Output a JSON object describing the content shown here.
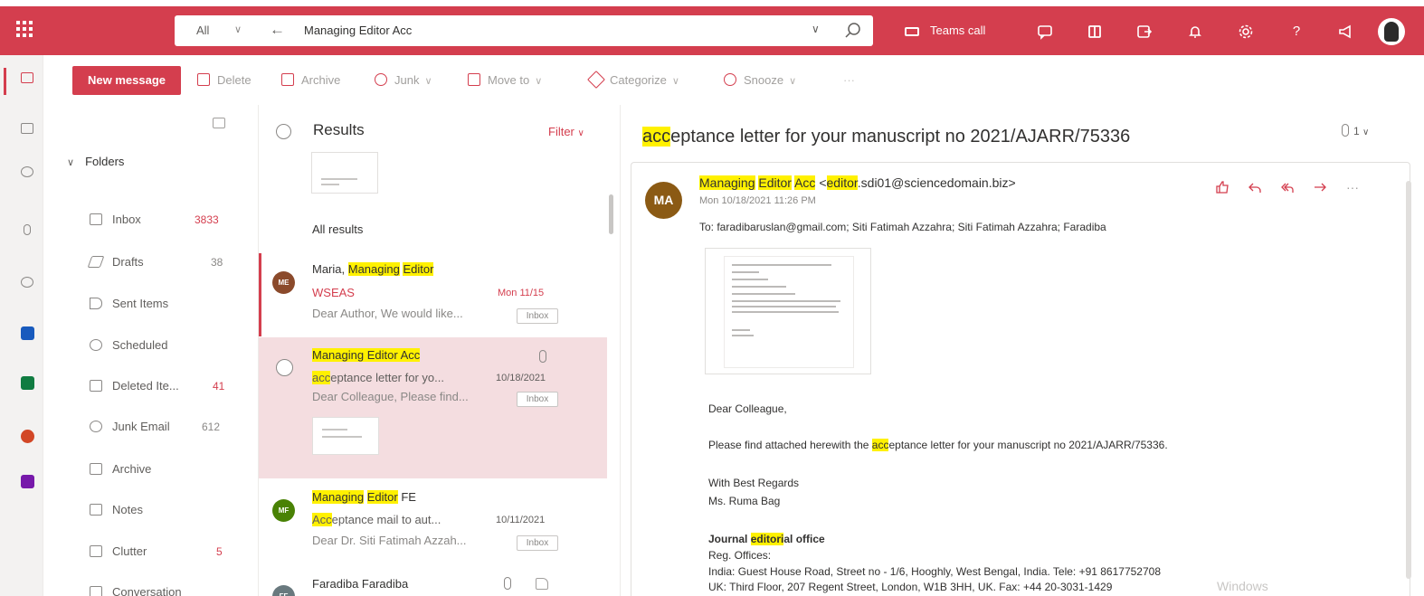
{
  "header": {
    "search_scope": "All",
    "search_query": "Managing Editor Acc",
    "teams_call": "Teams call"
  },
  "toolbar": {
    "new_message": "New message",
    "delete": "Delete",
    "archive": "Archive",
    "junk": "Junk",
    "move_to": "Move to",
    "categorize": "Categorize",
    "snooze": "Snooze",
    "more": "···"
  },
  "folders": {
    "title": "Folders",
    "items": [
      {
        "label": "Inbox",
        "count": "3833",
        "count_color": "red"
      },
      {
        "label": "Drafts",
        "count": "38",
        "count_color": "gray"
      },
      {
        "label": "Sent Items",
        "count": ""
      },
      {
        "label": "Scheduled",
        "count": ""
      },
      {
        "label": "Deleted Ite...",
        "count": "41",
        "count_color": "red"
      },
      {
        "label": "Junk Email",
        "count": "612",
        "count_color": "gray"
      },
      {
        "label": "Archive",
        "count": ""
      },
      {
        "label": "Notes",
        "count": ""
      },
      {
        "label": "Clutter",
        "count": "5",
        "count_color": "red"
      },
      {
        "label": "Conversation",
        "count": ""
      }
    ]
  },
  "list": {
    "title": "Results",
    "filter": "Filter",
    "section": "All results",
    "messages": [
      {
        "avatar": "ME",
        "avatar_color": "#8b4a2b",
        "sender_plain": "Maria, ",
        "sender_hl1": "Managing",
        "sender_hl2": "Editor",
        "subject": "WSEAS",
        "date": "Mon 11/15",
        "preview": "Dear Author, We would like...",
        "tag": "Inbox"
      },
      {
        "sender_hl1": "Managing Editor Acc",
        "subject_hl": "acc",
        "subject_rest": "eptance letter for yo...",
        "date": "10/18/2021",
        "preview": "Dear Colleague, Please find...",
        "tag": "Inbox"
      },
      {
        "avatar": "MF",
        "avatar_color": "#498205",
        "sender_hl1": "Managing",
        "sender_hl2": "Editor",
        "sender_rest": " FE",
        "subject_hl": "Acc",
        "subject_rest": "eptance mail to aut...",
        "date": "10/11/2021",
        "preview": "Dear Dr. Siti Fatimah Azzah...",
        "tag": "Inbox"
      },
      {
        "avatar": "FF",
        "avatar_color": "#69797e",
        "sender_plain": "Faradiba Faradiba"
      }
    ]
  },
  "reading": {
    "subject_hl": "acc",
    "subject_rest": "eptance letter for your manuscript no 2021/AJARR/75336",
    "attachment_count": "1",
    "avatar": "MA",
    "from_name_1": "Managing",
    "from_name_2": "Editor",
    "from_name_3": "Acc",
    "from_lt": " <",
    "from_email_hl": "editor",
    "from_email_rest": ".sdi01@sciencedomain.biz>",
    "date": "Mon 10/18/2021 11:26 PM",
    "to": "To:  faradibaruslan@gmail.com;  Siti Fatimah Azzahra;  Siti Fatimah Azzahra;  Faradiba",
    "greeting": "Dear Colleague,",
    "body_pre": "Please find attached herewith the ",
    "body_hl": "acc",
    "body_post": "eptance letter for your manuscript no 2021/AJARR/75336.",
    "regards": "With Best Regards",
    "signer": "Ms. Ruma Bag",
    "office_pre": "Journal ",
    "office_hl": "editori",
    "office_post": "al office",
    "reg_offices": "Reg. Offices:",
    "india": "India: Guest House Road, Street no - 1/6, Hooghly, West Bengal, India. Tele: +91 8617752708",
    "uk": "UK: Third Floor, 207 Regent Street, London, W1B 3HH, UK. Fax: +44 20-3031-1429"
  },
  "watermark": "Windows"
}
